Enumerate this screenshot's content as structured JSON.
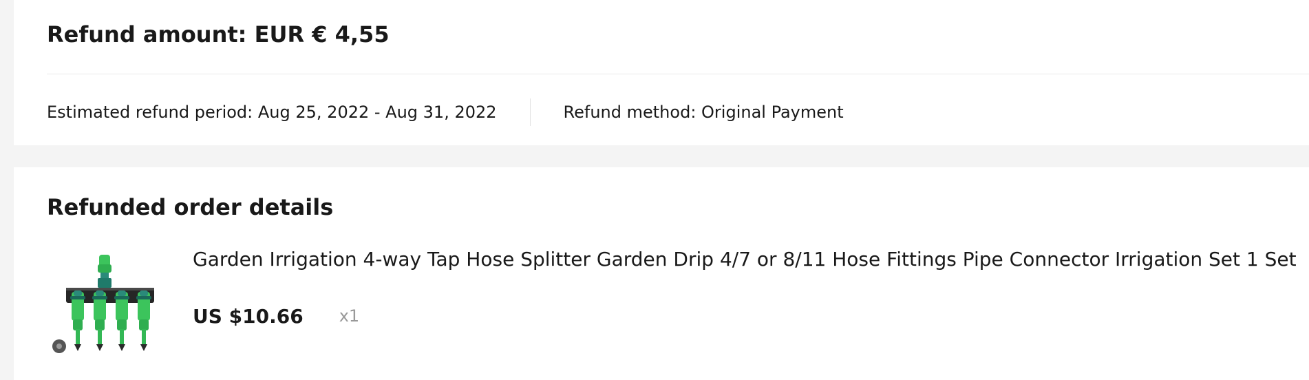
{
  "refund": {
    "amount_text": "Refund amount: EUR € 4,55",
    "period_text": "Estimated refund period: Aug 25, 2022 - Aug 31, 2022",
    "method_text": "Refund method: Original Payment"
  },
  "order_details": {
    "title": "Refunded order details",
    "items": [
      {
        "title": "Garden Irrigation 4-way Tap Hose Splitter Garden Drip 4/7 or 8/11 Hose Fittings Pipe Connector Irrigation Set 1 Set",
        "price": "US $10.66",
        "quantity": "x1",
        "image_icon": "hose-splitter-product-image"
      }
    ]
  },
  "colors": {
    "page_background": "#f4f4f4",
    "card_background": "#ffffff",
    "text_primary": "#191919",
    "text_muted": "#999999",
    "product_green": "#3cc45c",
    "product_black": "#2a2a2a"
  }
}
